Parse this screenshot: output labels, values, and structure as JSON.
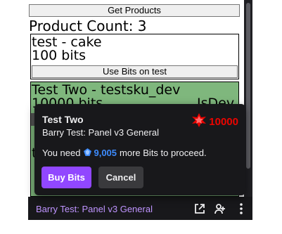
{
  "extension": {
    "get_products_label": "Get Products",
    "product_count_text": "Product Count: 3",
    "product1": {
      "title": "test - cake",
      "price": "100 bits",
      "use_bits_label": "Use Bits on test"
    },
    "product2": {
      "title": "Test Two - testsku_dev",
      "price": "10000 bits",
      "dev_flag": "IsDev",
      "partial_line": "t"
    }
  },
  "dialog": {
    "title": "Test Two",
    "subtitle": "Barry Test: Panel v3 General",
    "cost": "10000",
    "need_prefix": "You need",
    "bits_needed": "9,005",
    "need_suffix": "more Bits to proceed.",
    "buy_label": "Buy Bits",
    "cancel_label": "Cancel",
    "icons": [
      "bits-gem-red-icon",
      "bits-gem-blue-icon"
    ],
    "colors": {
      "buy": "#9147ff",
      "cost": "#eb0400",
      "bits": "#3d8bfd"
    }
  },
  "footer": {
    "title": "Barry Test: Panel v3 General",
    "icons": [
      "popout-icon",
      "manage-access-icon",
      "more-options-icon"
    ]
  }
}
